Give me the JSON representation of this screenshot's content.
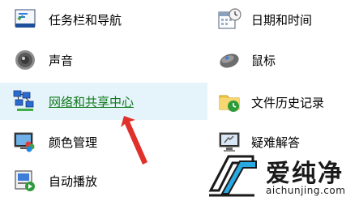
{
  "control_panel": {
    "left_column": [
      {
        "label": "任务栏和导航",
        "icon": "taskbar-icon"
      },
      {
        "label": "声音",
        "icon": "speaker-icon"
      },
      {
        "label": "网络和共享中心",
        "icon": "network-icon",
        "highlighted": true
      },
      {
        "label": "颜色管理",
        "icon": "color-management-icon"
      },
      {
        "label": "自动播放",
        "icon": "autoplay-icon"
      }
    ],
    "right_column": [
      {
        "label": "日期和时间",
        "icon": "calendar-clock-icon"
      },
      {
        "label": "鼠标",
        "icon": "mouse-icon"
      },
      {
        "label": "文件历史记录",
        "icon": "folder-history-icon"
      },
      {
        "label": "疑难解答",
        "icon": "troubleshooting-icon"
      }
    ]
  },
  "watermark": {
    "name": "爱纯净",
    "url": "aichunjing.com"
  },
  "colors": {
    "highlight_bg": "#e5f3fb",
    "link_green": "#0f7a1a",
    "arrow_red": "#e0302a"
  }
}
